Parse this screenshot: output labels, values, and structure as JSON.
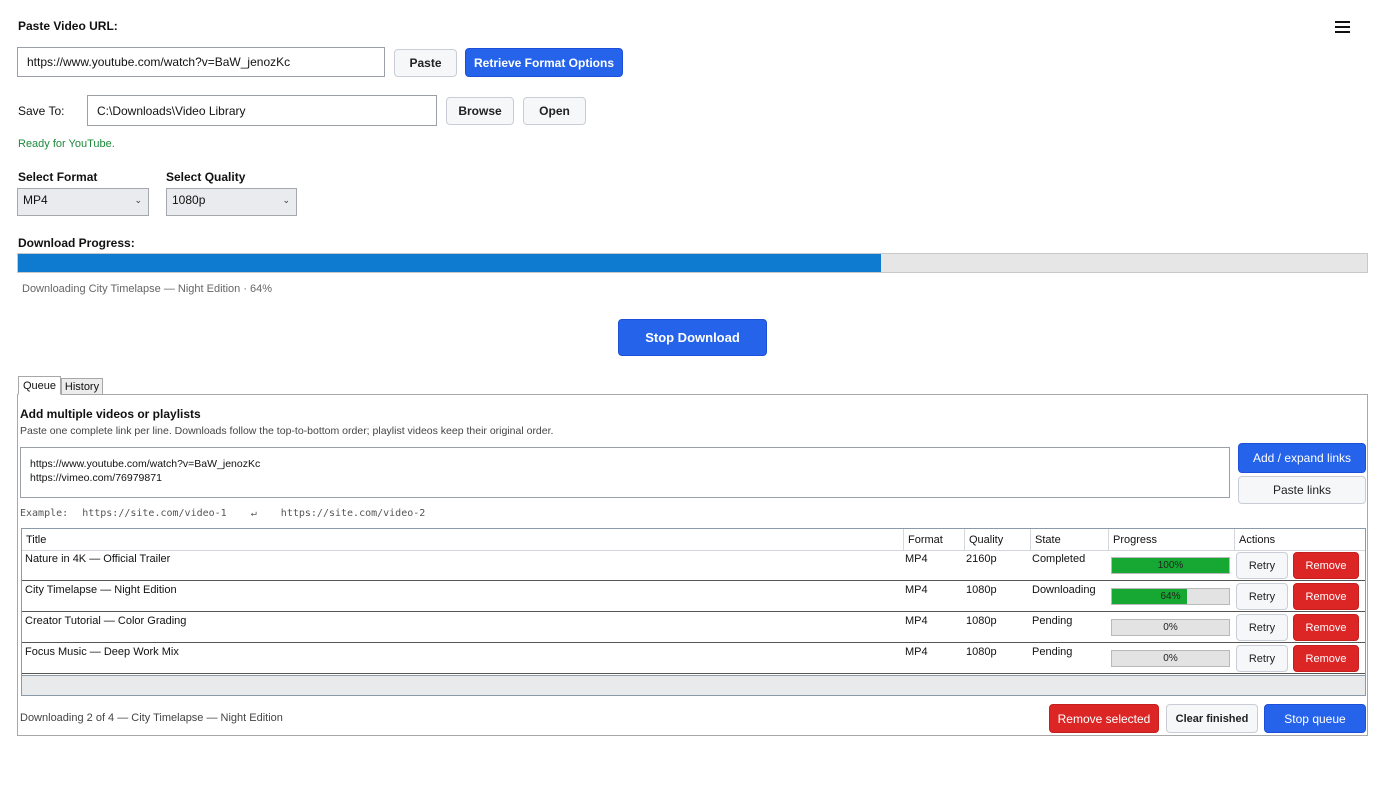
{
  "header": {
    "url_label": "Paste Video URL:",
    "menu_icon": "hamburger-menu-icon"
  },
  "url": {
    "value": "https://www.youtube.com/watch?v=BaW_jenozKc",
    "paste_label": "Paste",
    "retrieve_label": "Retrieve Format Options"
  },
  "save": {
    "label": "Save To:",
    "path": "C:\\Downloads\\Video Library",
    "browse_label": "Browse",
    "open_label": "Open"
  },
  "status": {
    "ready": "Ready for YouTube."
  },
  "format": {
    "label": "Select Format",
    "value": "MP4"
  },
  "quality": {
    "label": "Select Quality",
    "value": "1080p"
  },
  "progress": {
    "label": "Download Progress:",
    "percent": 64,
    "detail": "Downloading City Timelapse — Night Edition · 64%"
  },
  "stop_download_label": "Stop Download",
  "tabs": [
    {
      "label": "Queue",
      "active": true
    },
    {
      "label": "History",
      "active": false
    }
  ],
  "queue": {
    "heading": "Add multiple videos or playlists",
    "hint": "Paste one complete link per line. Downloads follow the top-to-bottom order; playlist videos keep their original order.",
    "links_text": "https://www.youtube.com/watch?v=BaW_jenozKc\nhttps://vimeo.com/76979871",
    "add_label": "Add / expand links",
    "paste_links_label": "Paste links",
    "example_label": "Example:",
    "example_1": "https://site.com/video-1",
    "example_arrow": "↵",
    "example_2": "https://site.com/video-2",
    "columns": [
      "Title",
      "Format",
      "Quality",
      "State",
      "Progress",
      "Actions"
    ],
    "rows": [
      {
        "title": "Nature in 4K — Official Trailer",
        "format": "MP4",
        "quality": "2160p",
        "state": "Completed",
        "progress": 100,
        "progress_label": "100%"
      },
      {
        "title": "City Timelapse — Night Edition",
        "format": "MP4",
        "quality": "1080p",
        "state": "Downloading",
        "progress": 64,
        "progress_label": "64%"
      },
      {
        "title": "Creator Tutorial — Color Grading",
        "format": "MP4",
        "quality": "1080p",
        "state": "Pending",
        "progress": 0,
        "progress_label": "0%"
      },
      {
        "title": "Focus Music — Deep Work Mix",
        "format": "MP4",
        "quality": "1080p",
        "state": "Pending",
        "progress": 0,
        "progress_label": "0%"
      }
    ],
    "retry_label": "Retry",
    "remove_label": "Remove",
    "footer_status": "Downloading 2 of 4 — City Timelapse — Night Edition",
    "remove_selected_label": "Remove selected",
    "clear_finished_label": "Clear finished",
    "stop_queue_label": "Stop queue"
  },
  "colors": {
    "accent": "#2563eb",
    "danger": "#dc2626",
    "progress": "#0f7bd0",
    "row_progress": "#16a832",
    "ready_text": "#1e8a3c"
  }
}
